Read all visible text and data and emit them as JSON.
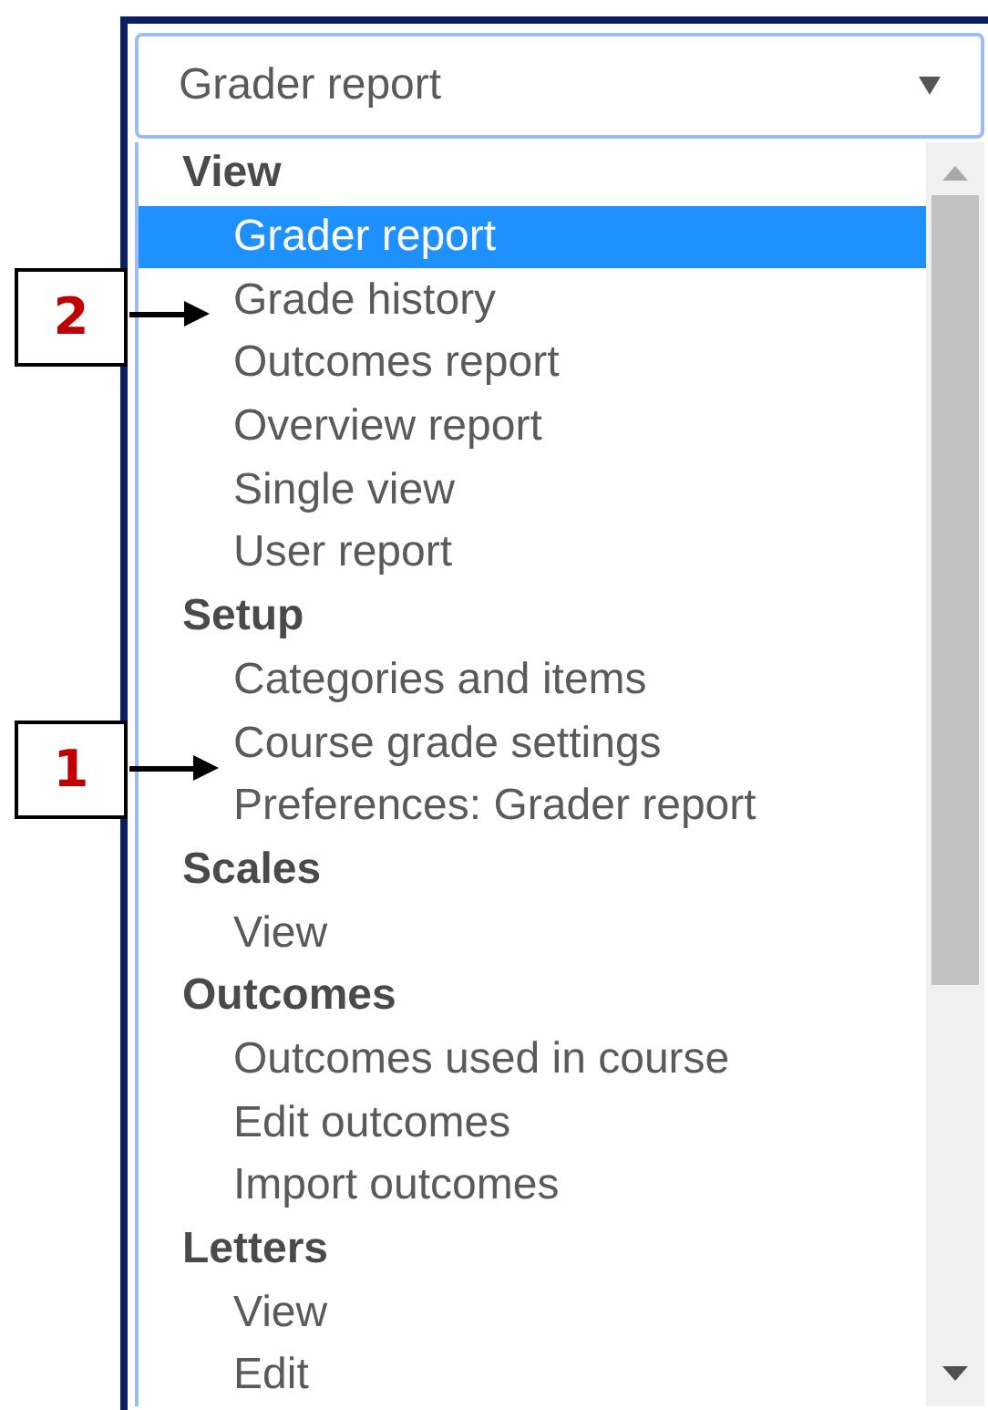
{
  "select": {
    "value": "Grader report"
  },
  "groups": [
    {
      "label": "View",
      "items": [
        {
          "label": "Grader report",
          "selected": true
        },
        {
          "label": "Grade history",
          "selected": false
        },
        {
          "label": "Outcomes report",
          "selected": false
        },
        {
          "label": "Overview report",
          "selected": false
        },
        {
          "label": "Single view",
          "selected": false
        },
        {
          "label": "User report",
          "selected": false
        }
      ]
    },
    {
      "label": "Setup",
      "items": [
        {
          "label": "Categories and items",
          "selected": false
        },
        {
          "label": "Course grade settings",
          "selected": false
        },
        {
          "label": "Preferences: Grader report",
          "selected": false
        }
      ]
    },
    {
      "label": "Scales",
      "items": [
        {
          "label": "View",
          "selected": false
        }
      ]
    },
    {
      "label": "Outcomes",
      "items": [
        {
          "label": "Outcomes used in course",
          "selected": false
        },
        {
          "label": "Edit outcomes",
          "selected": false
        },
        {
          "label": "Import outcomes",
          "selected": false
        }
      ]
    },
    {
      "label": "Letters",
      "items": [
        {
          "label": "View",
          "selected": false
        },
        {
          "label": "Edit",
          "selected": false
        }
      ]
    }
  ],
  "callouts": [
    {
      "number": "2"
    },
    {
      "number": "1"
    }
  ]
}
